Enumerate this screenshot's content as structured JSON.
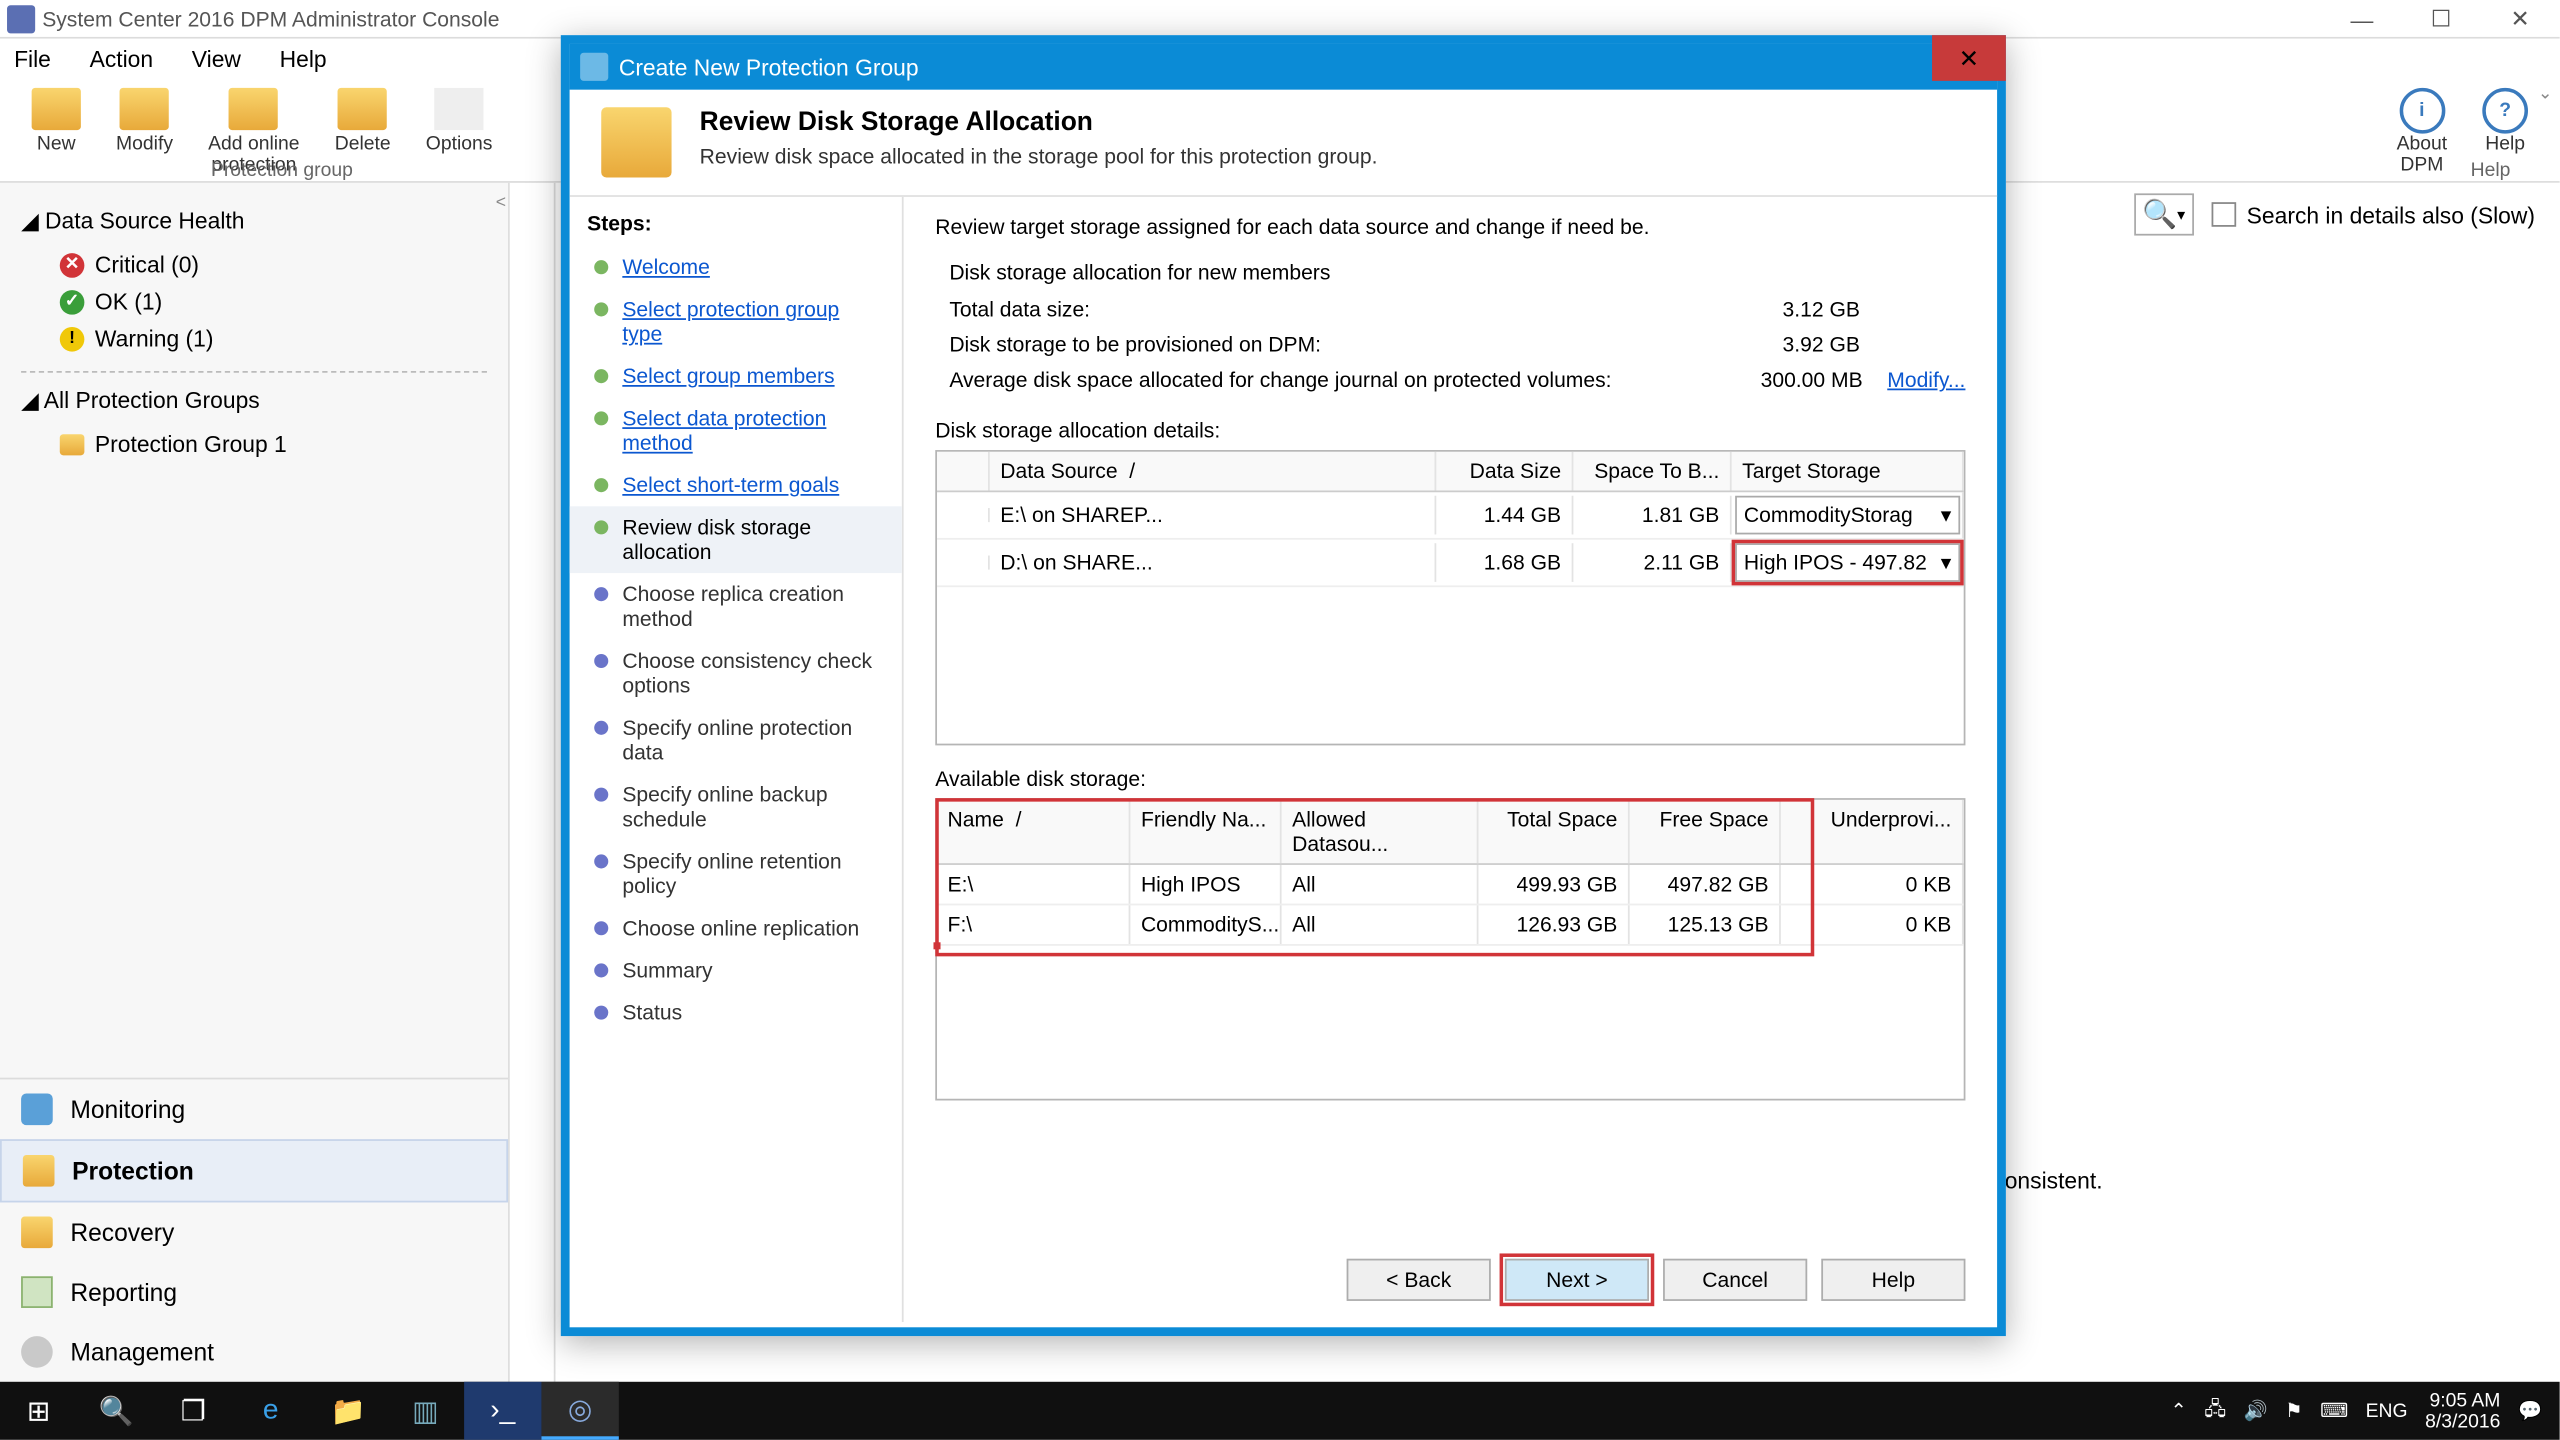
{
  "window": {
    "title": "System Center 2016 DPM Administrator Console"
  },
  "menu": {
    "file": "File",
    "action": "Action",
    "view": "View",
    "help": "Help"
  },
  "toolbar": {
    "new": "New",
    "modify": "Modify",
    "add_online": "Add online\nprotection",
    "delete": "Delete",
    "options": "Options",
    "about": "About\nDPM",
    "help": "Help",
    "group_label": "Protection group",
    "help_label": "Help"
  },
  "tree": {
    "health_header": "Data Source Health",
    "critical": "Critical  (0)",
    "ok": "OK  (1)",
    "warning": "Warning  (1)",
    "groups_header": "All Protection Groups",
    "group1": "Protection Group 1"
  },
  "nav": {
    "monitoring": "Monitoring",
    "protection": "Protection",
    "recovery": "Recovery",
    "reporting": "Reporting",
    "management": "Management"
  },
  "search": {
    "details": "Search in details also (Slow)"
  },
  "right_text": "consistent.",
  "modal": {
    "title": "Create New Protection Group",
    "header": "Review Disk Storage Allocation",
    "sub": "Review disk space allocated in the storage pool for this protection group.",
    "steps_label": "Steps:",
    "steps": {
      "welcome": "Welcome",
      "sel_type": "Select protection group type",
      "sel_members": "Select group members",
      "sel_method": "Select data protection method",
      "short_goals": "Select short-term goals",
      "review": "Review disk storage allocation",
      "replica": "Choose replica creation method",
      "consistency": "Choose consistency check options",
      "online_data": "Specify online protection data",
      "online_sched": "Specify online backup schedule",
      "online_ret": "Specify online retention policy",
      "online_repl": "Choose online replication",
      "summary": "Summary",
      "status": "Status"
    },
    "intro": "Review target storage assigned for each data source and change if need be.",
    "alloc_header": "Disk storage allocation for new members",
    "alloc": {
      "total_label": "Total data size:",
      "total_val": "3.12 GB",
      "prov_label": "Disk storage to be provisioned on DPM:",
      "prov_val": "3.92 GB",
      "journal_label": "Average disk space allocated for change journal on protected volumes:",
      "journal_val": "300.00 MB",
      "modify": "Modify..."
    },
    "details_label": "Disk storage allocation details:",
    "details_cols": {
      "ds": "Data Source",
      "sz": "Data Size",
      "sp": "Space To B...",
      "ts": "Target Storage"
    },
    "details_rows": [
      {
        "ds": "E:\\  on  SHAREP...",
        "sz": "1.44 GB",
        "sp": "1.81 GB",
        "ts": "CommodityStorag"
      },
      {
        "ds": "D:\\  on  SHARE...",
        "sz": "1.68 GB",
        "sp": "2.11 GB",
        "ts": "High IPOS - 497.82"
      }
    ],
    "avail_label": "Available disk storage:",
    "avail_cols": {
      "nm": "Name",
      "fr": "Friendly Na...",
      "al": "Allowed Datasou...",
      "ts": "Total Space",
      "fs": "Free Space",
      "up": "Underprovi..."
    },
    "avail_rows": [
      {
        "nm": "E:\\",
        "fr": "High IPOS",
        "al": "All",
        "ts": "499.93 GB",
        "fs": "497.82 GB",
        "up": "0 KB"
      },
      {
        "nm": "F:\\",
        "fr": "CommodityS...",
        "al": "All",
        "ts": "126.93 GB",
        "fs": "125.13 GB",
        "up": "0 KB"
      }
    ],
    "buttons": {
      "back": "< Back",
      "next": "Next >",
      "cancel": "Cancel",
      "help": "Help"
    }
  },
  "tray": {
    "lang": "ENG",
    "time": "9:05 AM",
    "date": "8/3/2016"
  }
}
